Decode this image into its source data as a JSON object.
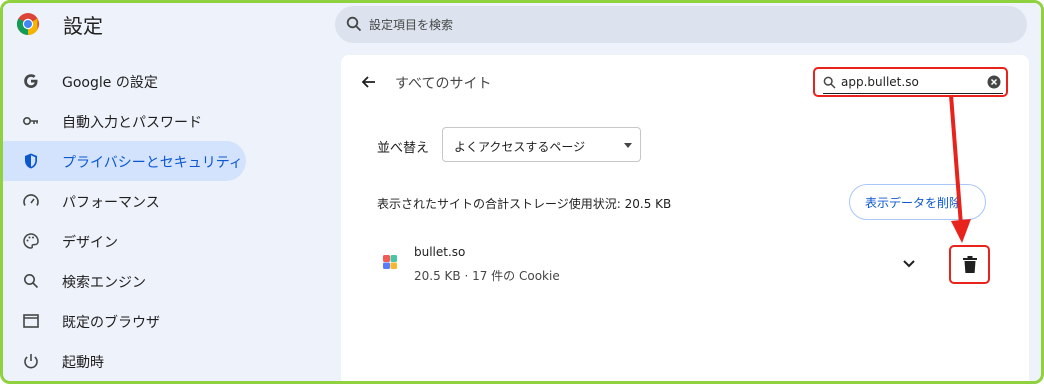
{
  "header": {
    "title": "設定",
    "search_placeholder": "設定項目を検索"
  },
  "sidebar": {
    "items": [
      {
        "label": "Google の設定",
        "icon": "google-g-icon",
        "active": false
      },
      {
        "label": "自動入力とパスワード",
        "icon": "key-icon",
        "active": false
      },
      {
        "label": "プライバシーとセキュリティ",
        "icon": "shield-icon",
        "active": true
      },
      {
        "label": "パフォーマンス",
        "icon": "speedometer-icon",
        "active": false
      },
      {
        "label": "デザイン",
        "icon": "palette-icon",
        "active": false
      },
      {
        "label": "検索エンジン",
        "icon": "search-icon",
        "active": false
      },
      {
        "label": "既定のブラウザ",
        "icon": "browser-window-icon",
        "active": false
      },
      {
        "label": "起動時",
        "icon": "power-icon",
        "active": false
      }
    ]
  },
  "main": {
    "page_title": "すべてのサイト",
    "site_search_value": "app.bullet.so",
    "sort_label": "並べ替え",
    "sort_value": "よくアクセスするページ",
    "storage_text": "表示されたサイトの合計ストレージ使用状況: 20.5 KB",
    "clear_button_label": "表示データを削除",
    "site": {
      "name": "bullet.so",
      "meta": "20.5 KB · 17 件の Cookie"
    }
  },
  "colors": {
    "frame_border": "#8fd13f",
    "accent": "#0b57d0",
    "active_bg": "#d3e3fd",
    "annotation_red": "#e8231b"
  }
}
